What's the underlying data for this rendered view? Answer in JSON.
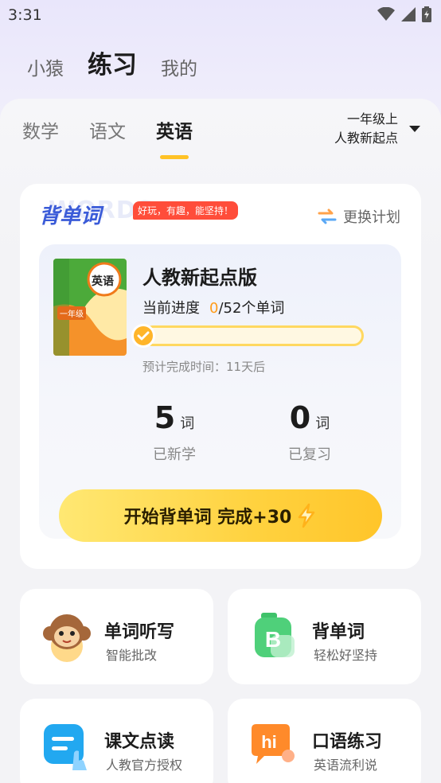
{
  "status_bar": {
    "time": "3:31"
  },
  "top_nav": {
    "items": [
      "小猿",
      "练习",
      "我的"
    ],
    "active": "练习"
  },
  "subject_tabs": {
    "items": [
      "数学",
      "语文",
      "英语"
    ],
    "active": "英语"
  },
  "grade_select": {
    "grade": "一年级上",
    "edition": "人教新起点"
  },
  "vocab_card": {
    "title": "背单词",
    "bg_word": "WORDS",
    "slogan": "好玩，有趣，能坚持！",
    "change_plan": "更换计划",
    "book": {
      "cover_subject": "英语",
      "cover_grade": "一年级",
      "name": "人教新起点版",
      "progress_label": "当前进度",
      "progress_current": "0",
      "progress_total": "/52个单词",
      "progress_fraction": 0,
      "eta": "预计完成时间：11天后"
    },
    "stats": {
      "new": {
        "value": "5",
        "unit": "词",
        "label": "已新学"
      },
      "review": {
        "value": "0",
        "unit": "词",
        "label": "已复习"
      }
    },
    "start_button": "开始背单词 完成+30"
  },
  "tiles": [
    {
      "title": "单词听写",
      "subtitle": "智能批改",
      "icon": "monkey-mascot-icon"
    },
    {
      "title": "背单词",
      "subtitle": "轻松好坚持",
      "icon": "letter-b-icon"
    },
    {
      "title": "课文点读",
      "subtitle": "人教官方授权",
      "icon": "text-pointer-icon"
    },
    {
      "title": "口语练习",
      "subtitle": "英语流利说",
      "icon": "hi-speech-icon"
    }
  ],
  "colors": {
    "accent": "#ffc226",
    "title_blue": "#3a5bd8",
    "badge_red": "#ff4d3a",
    "progress_orange": "#ff9c1a"
  }
}
